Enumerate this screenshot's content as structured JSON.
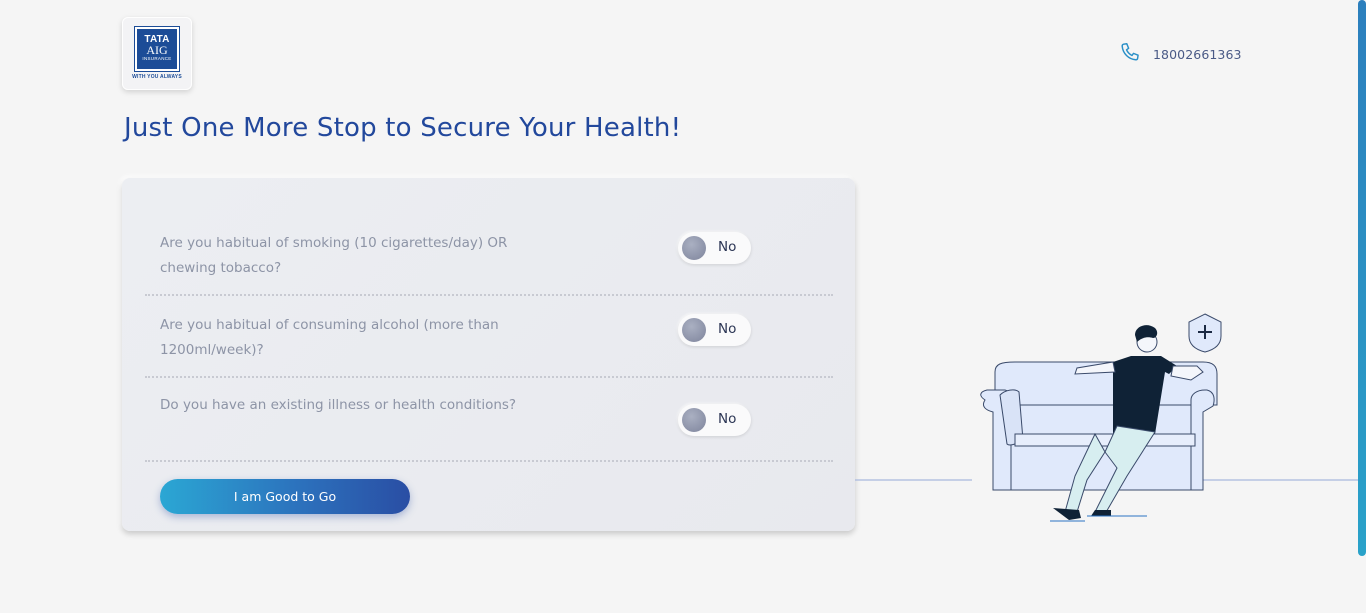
{
  "header": {
    "logo": {
      "brand": "TATA",
      "brand2": "AIG",
      "sub": "INSURANCE",
      "tagline": "WITH YOU ALWAYS"
    },
    "phone": "18002661363"
  },
  "title": "Just One More Stop to Secure Your Health!",
  "questions": [
    {
      "text": "Are you habitual of smoking (10 cigarettes/day) OR chewing tobacco?",
      "toggle": "No"
    },
    {
      "text": "Are you habitual of consuming alcohol (more than 1200ml/week)?",
      "toggle": "No"
    },
    {
      "text": "Do you have an existing illness or health conditions?",
      "toggle": "No"
    }
  ],
  "cta_label": "I am Good to Go",
  "colors": {
    "title": "#22489c",
    "accent_start": "#2ba7d4",
    "accent_end": "#2a4ea4"
  }
}
